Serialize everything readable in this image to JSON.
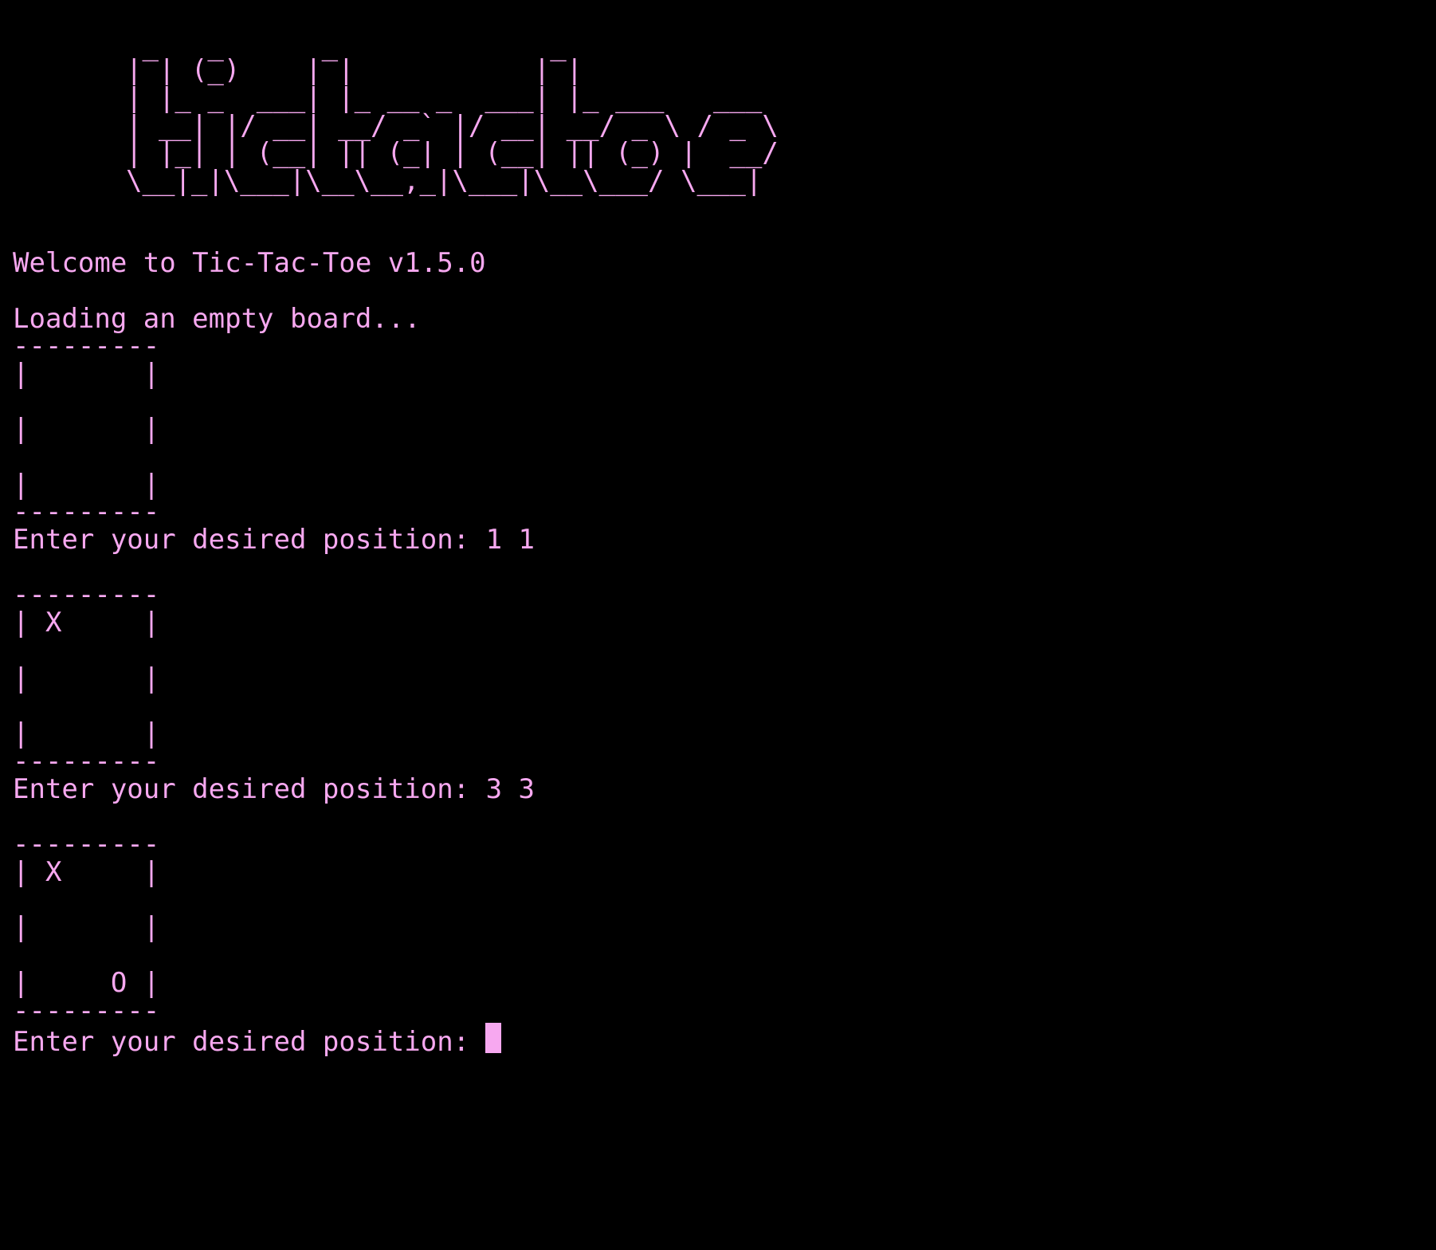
{
  "terminal": {
    "text_color": "#f7a8f0",
    "background": "#000000",
    "banner": [
      " _   _      _             _",
      "| | (_)    | |           | |",
      "| |_ _  ___| |_ __ _  ___| |_ ___   ___",
      "| __| |/ __| __/ _` |/ __| __/ _ \\ / _ \\",
      "| |_| | (__| || (_| | (__| || (_) |  __/",
      "\\__|_|\\___|\\__\\__,_|\\___|\\__\\___/ \\___|"
    ],
    "welcome": "Welcome to Tic-Tac-Toe v1.5.0",
    "loading": "Loading an empty board...",
    "board1": {
      "top": "---------",
      "row1": "|       |",
      "row2": "|       |",
      "row3": "|       |",
      "bottom": "---------"
    },
    "prompt1": "Enter your desired position: 1 1",
    "board2": {
      "top": "---------",
      "row1": "| X     |",
      "row2": "|       |",
      "row3": "|       |",
      "bottom": "---------"
    },
    "prompt2": "Enter your desired position: 3 3",
    "board3": {
      "top": "---------",
      "row1": "| X     |",
      "row2": "|       |",
      "row3": "|     O |",
      "bottom": "---------"
    },
    "prompt3": "Enter your desired position:"
  }
}
